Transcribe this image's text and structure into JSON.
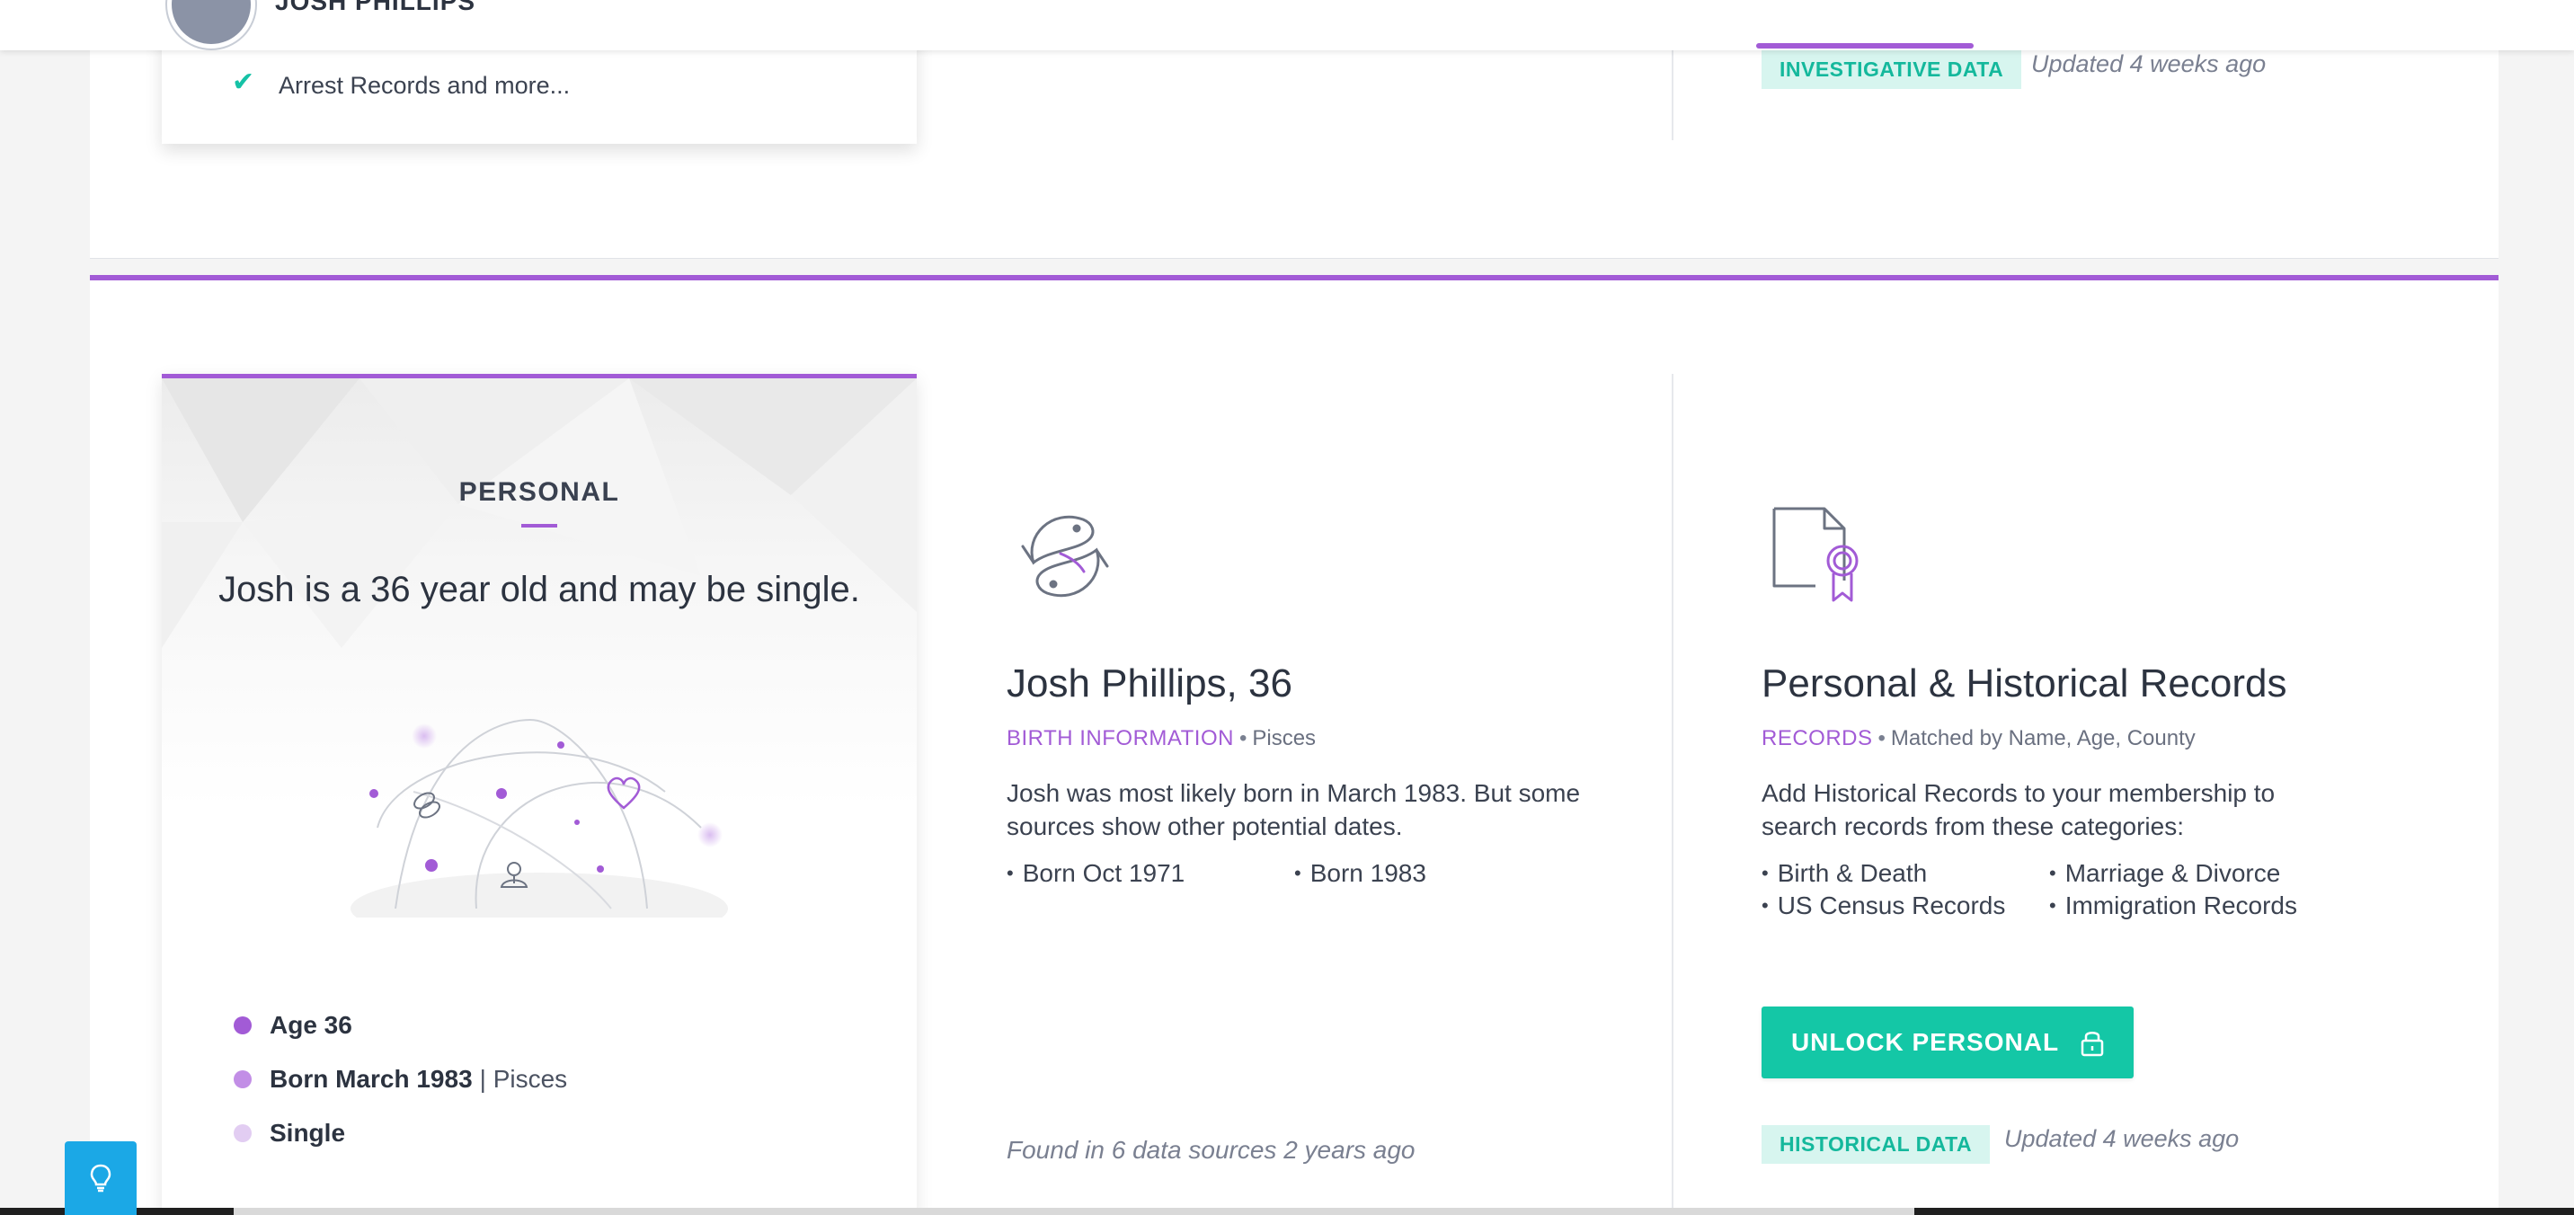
{
  "header": {
    "name": "JOSH PHILLIPS"
  },
  "prev_section": {
    "check_item": "Arrest Records and more...",
    "tag": "INVESTIGATIVE DATA",
    "updated": "Updated 4 weeks ago"
  },
  "personal_card": {
    "label": "PERSONAL",
    "headline": "Josh is a 36 year old and may be single.",
    "facts": [
      {
        "strong": "Age 36",
        "rest": "",
        "dot_color": "#a25bd6"
      },
      {
        "strong": "Born March 1983",
        "rest": "| Pisces",
        "dot_color": "#c28ee6"
      },
      {
        "strong": "Single",
        "rest": "",
        "dot_color": "#e2cdf2"
      }
    ]
  },
  "birth": {
    "icon": "pisces-zodiac-icon",
    "title": "Josh Phillips, 36",
    "kind": "BIRTH INFORMATION",
    "detail": "Pisces",
    "description": "Josh was most likely born in March 1983. But some sources show other potential dates.",
    "bullets": [
      "Born Oct 1971",
      "Born 1983"
    ],
    "found": "Found in 6 data sources 2 years ago"
  },
  "records": {
    "icon": "certificate-document-icon",
    "title": "Personal & Historical Records",
    "kind": "RECORDS",
    "detail": "Matched by Name, Age, County",
    "description": "Add Historical Records to your membership to search records from these categories:",
    "bullets": [
      "Birth & Death",
      "Marriage & Divorce",
      "US Census Records",
      "Immigration Records"
    ],
    "button": "UNLOCK PERSONAL",
    "tag": "HISTORICAL DATA",
    "updated": "Updated 4 weeks ago"
  },
  "colors": {
    "accent": "#a25bd6",
    "teal": "#14c7a6",
    "help": "#1ba8e6"
  }
}
